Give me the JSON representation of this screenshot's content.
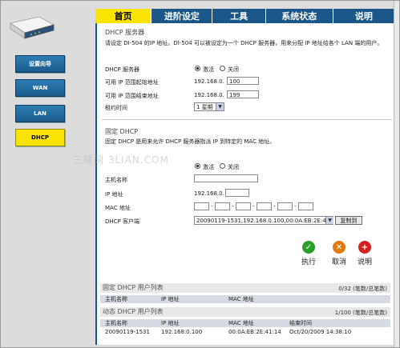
{
  "nav": {
    "items": [
      {
        "label": "设置向导"
      },
      {
        "label": "WAN"
      },
      {
        "label": "LAN"
      },
      {
        "label": "DHCP"
      }
    ]
  },
  "tabs": [
    {
      "label": "首页"
    },
    {
      "label": "进阶设定"
    },
    {
      "label": "工具"
    },
    {
      "label": "系统状态"
    },
    {
      "label": "说明"
    }
  ],
  "dhcp_server": {
    "title": "DHCP 服务器",
    "description": "请设定 DI-504 的IP 地址。DI-504 可以被设定为一个 DHCP 服务器，用来分配 IP 地址给各个 LAN 端的用户。",
    "server_label": "DHCP 服务器",
    "enable_label": "激活",
    "disable_label": "关闭",
    "start_label": "可用 IP 范围起始地址",
    "end_label": "可用 IP 范围结束地址",
    "ip_prefix": "192.168.0.",
    "start_value": "100",
    "end_value": "199",
    "lease_label": "租约时间",
    "lease_value": "1 星期"
  },
  "static_dhcp": {
    "title": "固定 DHCP",
    "description": "固定 DHCP 是用来允许 DHCP 服务器指派 IP 到特定的 MAC 地址。",
    "enable_label": "激活",
    "disable_label": "关闭",
    "host_label": "主机名称",
    "ip_label": "IP 地址",
    "ip_prefix": "192.168.0.",
    "mac_label": "MAC 地址",
    "mac_sep": "-",
    "client_label": "DHCP 客户端",
    "client_value": "20090119-1531,192.168.0.100,00:0A:EB:2E:41:",
    "copy_button": "复制到"
  },
  "actions": [
    {
      "label": "执行",
      "icon": "check-icon",
      "color": "#2aa02a"
    },
    {
      "label": "取消",
      "icon": "cross-icon",
      "color": "#e07a10"
    },
    {
      "label": "说明",
      "icon": "plus-icon",
      "color": "#d42020"
    }
  ],
  "static_list": {
    "title": "固定 DHCP 用户列表",
    "count": "0/32 (笔数/总笔数)",
    "headers": [
      "主机名称",
      "IP 地址",
      "MAC 地址"
    ]
  },
  "dynamic_list": {
    "title": "动态 DHCP 用户列表",
    "count": "1/100 (笔数/总笔数)",
    "headers": [
      "主机名称",
      "IP 地址",
      "MAC 地址",
      "结束时间"
    ],
    "rows": [
      {
        "host": "20090119-1531",
        "ip": "192.168.0.100",
        "mac": "00:0A:EB:2E:41:14",
        "expire": "Oct/20/2009 14:38:10"
      }
    ]
  },
  "watermark": "三联网 3LIAN.COM"
}
